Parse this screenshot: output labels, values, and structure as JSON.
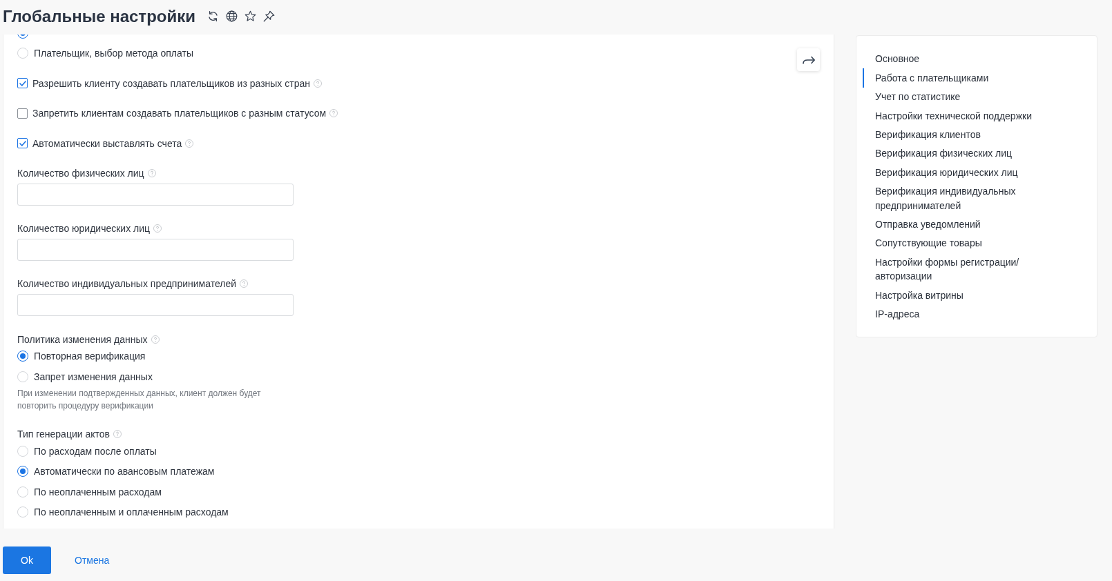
{
  "header": {
    "title": "Глобальные настройки"
  },
  "form": [
    {
      "kind": "radio_group",
      "options": [
        {
          "selected": true
        },
        {
          "label": "Плательщик, выбор метода оплаты",
          "selected": false
        }
      ]
    },
    {
      "kind": "checkbox",
      "label": "Разрешить клиенту создавать плательщиков из разных стран",
      "checked": true,
      "help": true
    },
    {
      "kind": "checkbox",
      "label": "Запретить клиентам создавать плательщиков с разным статусом",
      "checked": false,
      "help": true
    },
    {
      "kind": "checkbox",
      "label": "Автоматически выставлять счета",
      "checked": true,
      "help": true
    },
    {
      "kind": "number_field",
      "label": "Количество физических лиц",
      "help": true
    },
    {
      "kind": "number_field",
      "label": "Количество юридических лиц",
      "help": true
    },
    {
      "kind": "number_field",
      "label": "Количество индивидуальных предпринимателей",
      "help": true
    },
    {
      "kind": "radio_group",
      "label": "Политика изменения данных",
      "help": true,
      "options": [
        {
          "label": "Повторная верификация",
          "selected": true
        },
        {
          "label": "Запрет изменения данных",
          "selected": false
        }
      ],
      "hint": "При изменении подтвержденных данных, клиент должен будет повторить процедуру верификации"
    },
    {
      "kind": "radio_group",
      "label": "Тип генерации актов",
      "help": true,
      "options": [
        {
          "label": "По расходам после оплаты",
          "selected": false
        },
        {
          "label": "Автоматически по авансовым платежам",
          "selected": true
        },
        {
          "label": "По неоплаченным расходам",
          "selected": false
        },
        {
          "label": "По неоплаченным и оплаченным расходам",
          "selected": false
        }
      ]
    }
  ],
  "navigation": {
    "items": [
      {
        "label": "Основное",
        "selected": false
      },
      {
        "label": "Работа с плательщиками",
        "selected": true
      },
      {
        "label": "Учет по статистике",
        "selected": false
      },
      {
        "label": "Настройки технической поддержки",
        "selected": false
      },
      {
        "label": "Верификация клиентов",
        "selected": false
      },
      {
        "label": "Верификация физических лиц",
        "selected": false
      },
      {
        "label": "Верификация юридических лиц",
        "selected": false
      },
      {
        "label": "Верификация индивидуальных предпринимателей",
        "selected": false
      },
      {
        "label": "Отправка уведомлений",
        "selected": false
      },
      {
        "label": "Сопутствующие товары",
        "selected": false
      },
      {
        "label": "Настройки формы регистрации/ авторизации",
        "selected": false
      },
      {
        "label": "Настройка витрины",
        "selected": false
      },
      {
        "label": "IP-адреса",
        "selected": false
      }
    ]
  },
  "actions": [
    {
      "kind": "primary",
      "label": "Ok"
    },
    {
      "kind": "link",
      "label": "Отмена"
    }
  ]
}
